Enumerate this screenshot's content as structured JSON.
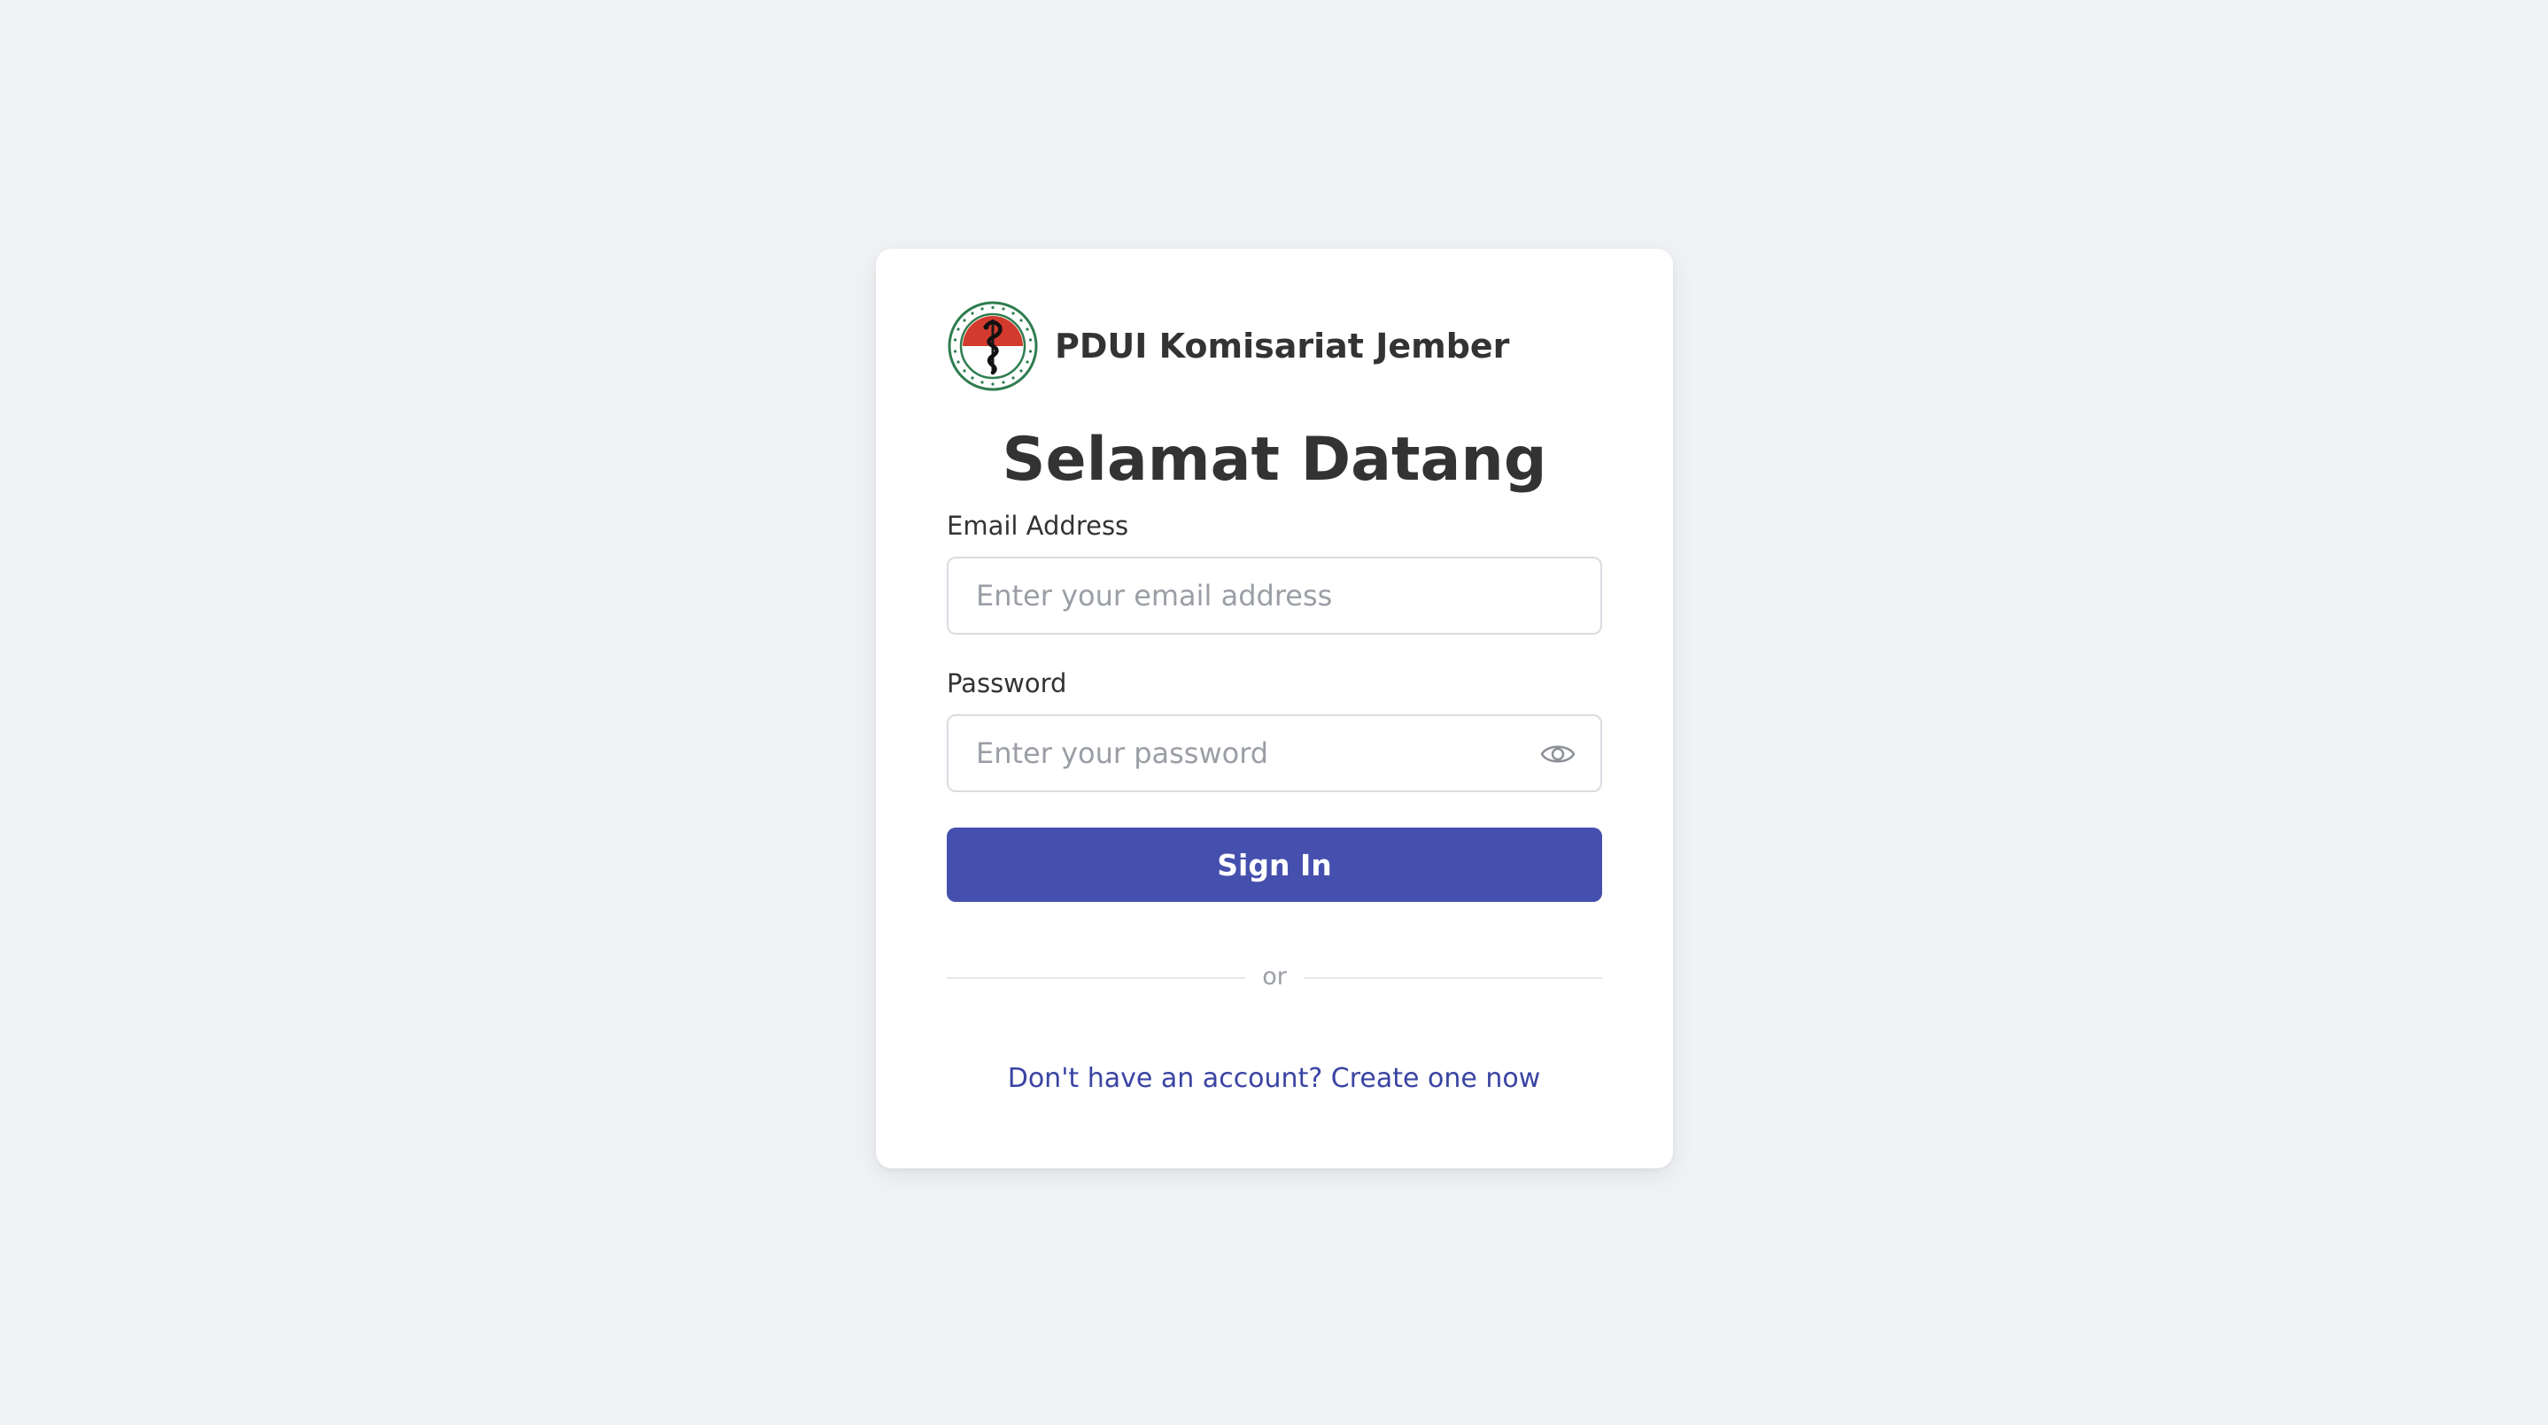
{
  "brand": {
    "name": "PDUI Komisariat Jember",
    "logo_icon": "pdui-emblem-icon",
    "logo_text": "PERHIMPUNAN DOKTER UMUM INDONESIA • PDUI •"
  },
  "heading": "Selamat Datang",
  "email": {
    "label": "Email Address",
    "value": "",
    "placeholder": "Enter your email address"
  },
  "password": {
    "label": "Password",
    "value": "",
    "placeholder": "Enter your password",
    "toggle_icon": "eye-icon"
  },
  "sign_in_label": "Sign In",
  "divider_text": "or",
  "register_link": "Don't have an account? Create one now",
  "colors": {
    "background": "#f0f2f5",
    "card": "#ffffff",
    "primary": "#4550ae",
    "link": "#3a44a3",
    "text": "#333333",
    "logo_red": "#d23a2d",
    "logo_green": "#2e7d4f"
  }
}
